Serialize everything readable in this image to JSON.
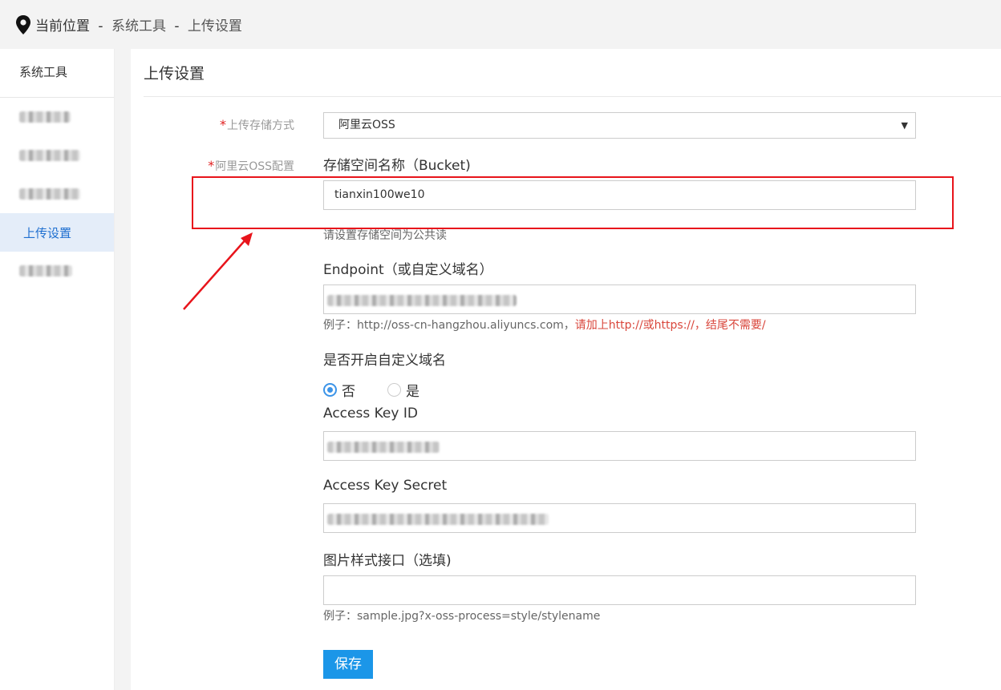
{
  "breadcrumb": {
    "current_label": "当前位置",
    "sep": "-",
    "level1": "系统工具",
    "level2": "上传设置"
  },
  "sidebar": {
    "title": "系统工具",
    "items": [
      {
        "label": "",
        "blurred": true
      },
      {
        "label": "",
        "blurred": true
      },
      {
        "label": "",
        "blurred": true
      },
      {
        "label": "上传设置",
        "active": true
      },
      {
        "label": "",
        "blurred": true
      }
    ]
  },
  "page": {
    "title": "上传设置"
  },
  "form": {
    "storage_label": "上传存储方式",
    "storage_value": "阿里云OSS",
    "oss_label": "阿里云OSS配置",
    "required_mark": "*",
    "bucket": {
      "label": "存储空间名称（Bucket)",
      "value": "tianxin100we10",
      "hint": "请设置存储空间为公共读"
    },
    "endpoint": {
      "label": "Endpoint（或自定义域名）",
      "hint_prefix": "例子：http://oss-cn-hangzhou.aliyuncs.com，",
      "hint_warn": "请加上http://或https://，结尾不需要/"
    },
    "custom_domain": {
      "label": "是否开启自定义域名",
      "option_no": "否",
      "option_yes": "是",
      "selected": "否"
    },
    "access_key_id": {
      "label": "Access Key ID"
    },
    "access_key_secret": {
      "label": "Access Key Secret"
    },
    "image_style": {
      "label": "图片样式接口（选填)",
      "value": "",
      "hint": "例子：sample.jpg?x-oss-process=style/stylename"
    },
    "save_label": "保存"
  },
  "colors": {
    "accent": "#1b96e8",
    "highlight": "#e8141b",
    "warn": "#d9463b",
    "active_bg": "#e4edf9"
  }
}
